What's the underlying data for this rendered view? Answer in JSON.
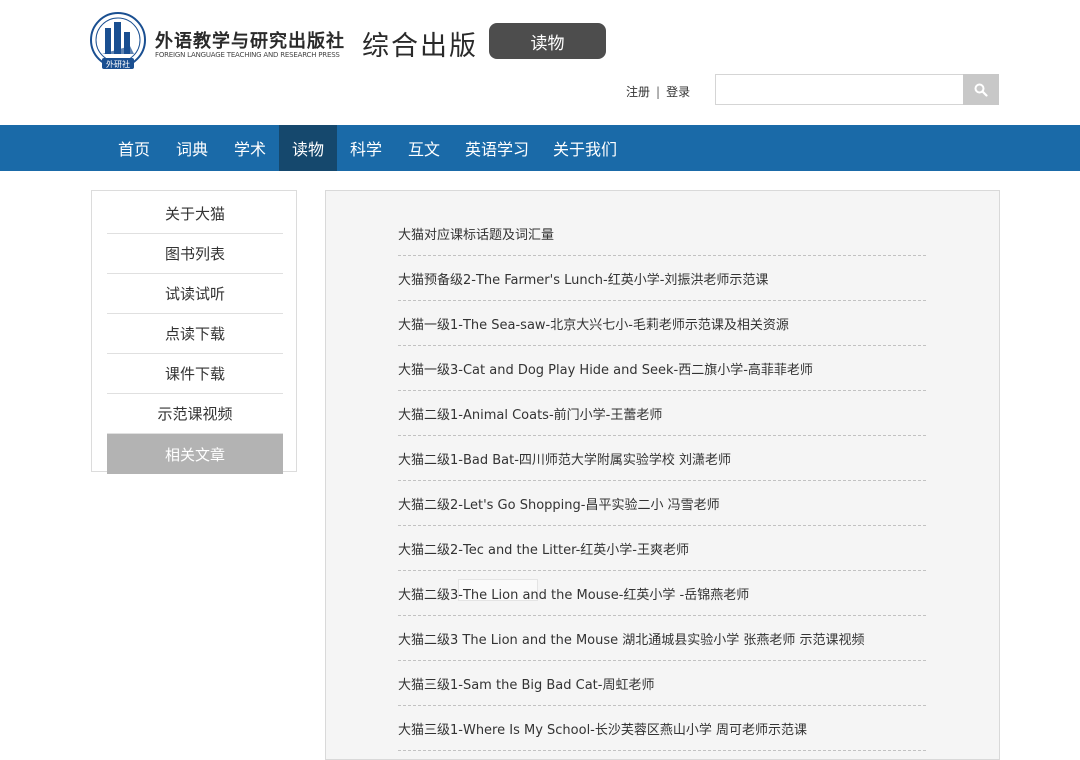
{
  "header": {
    "publisher_cn": "外语教学与研究出版社",
    "publisher_en": "FOREIGN LANGUAGE TEACHING AND RESEARCH PRESS",
    "logo_text": "外研社",
    "site_title": "综合出版",
    "section_badge": "读物",
    "register": "注册",
    "separator": "|",
    "login": "登录",
    "search_placeholder": "",
    "search_icon": "search-icon",
    "colors": {
      "logo": "#1a4f91",
      "badge": "#4d4d4d"
    }
  },
  "nav": {
    "items": [
      {
        "label": "首页"
      },
      {
        "label": "词典"
      },
      {
        "label": "学术"
      },
      {
        "label": "读物",
        "active": true
      },
      {
        "label": "科学"
      },
      {
        "label": "互文"
      },
      {
        "label": "英语学习"
      },
      {
        "label": "关于我们"
      }
    ],
    "colors": {
      "bar": "#1a6aa8",
      "active": "#15486d"
    }
  },
  "sidebar": {
    "items": [
      {
        "label": "关于大猫"
      },
      {
        "label": "图书列表"
      },
      {
        "label": "试读试听"
      },
      {
        "label": "点读下载"
      },
      {
        "label": "课件下载"
      },
      {
        "label": "示范课视频"
      },
      {
        "label": "相关文章",
        "active": true
      }
    ],
    "colors": {
      "active": "#b3b3b3"
    }
  },
  "articles": [
    "大猫对应课标话题及词汇量",
    "大猫预备级2-The Farmer's Lunch-红英小学-刘振洪老师示范课",
    "大猫一级1-The Sea-saw-北京大兴七小-毛莉老师示范课及相关资源",
    "大猫一级3-Cat and Dog Play Hide and Seek-西二旗小学-高菲菲老师",
    "大猫二级1-Animal Coats-前门小学-王蕾老师",
    "大猫二级1-Bad Bat-四川师范大学附属实验学校 刘潇老师",
    "大猫二级2-Let's Go Shopping-昌平实验二小 冯雪老师",
    "大猫二级2-Tec and the Litter-红英小学-王爽老师",
    "大猫二级3-The Lion and the Mouse-红英小学 -岳锦燕老师",
    "大猫二级3 The Lion and the Mouse 湖北通城县实验小学 张燕老师 示范课视频",
    "大猫三级1-Sam the Big Bad Cat-周虹老师",
    "大猫三级1-Where Is My School-长沙芙蓉区燕山小学 周可老师示范课"
  ]
}
